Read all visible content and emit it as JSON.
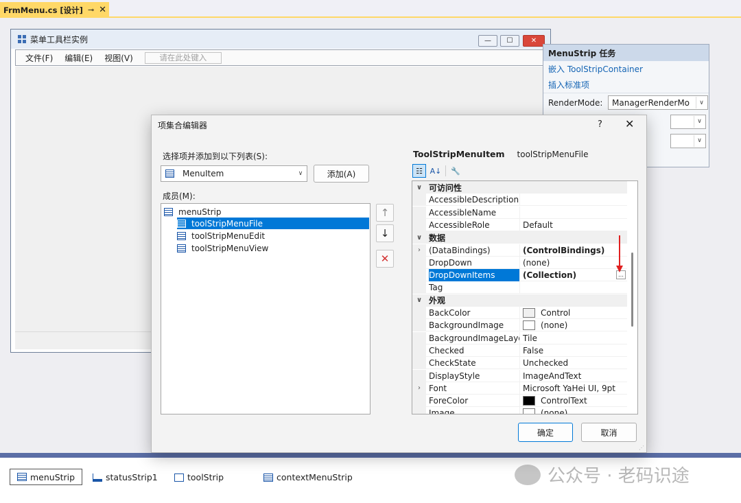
{
  "tab": {
    "title": "FrmMenu.cs [设计]",
    "pin": "⊸",
    "close": "✕"
  },
  "form": {
    "title": "菜单工具栏实例",
    "controls": {
      "minimize": "—",
      "maximize": "☐",
      "close": "✕"
    },
    "menu": [
      "文件(F)",
      "编辑(E)",
      "视图(V)"
    ],
    "type_here": "请在此处键入"
  },
  "tasks": {
    "header": "MenuStrip 任务",
    "links": [
      "嵌入 ToolStripContainer",
      "插入标准项"
    ],
    "render_mode_label": "RenderMode:",
    "render_mode_value": "ManagerRenderMo"
  },
  "dialog": {
    "title": "项集合编辑器",
    "help": "?",
    "close": "✕",
    "select_label": "选择项并添加到以下列表(S):",
    "select_value": "MenuItem",
    "add_button": "添加(A)",
    "members_label": "成员(M):",
    "members": [
      {
        "label": "menuStrip",
        "selected": false
      },
      {
        "label": "toolStripMenuFile",
        "selected": true
      },
      {
        "label": "toolStripMenuEdit",
        "selected": false
      },
      {
        "label": "toolStripMenuView",
        "selected": false
      }
    ],
    "move_up": "↑",
    "move_down": "↓",
    "delete": "✕",
    "prop_header_type": "ToolStripMenuItem",
    "prop_header_name": "toolStripMenuFile",
    "properties": [
      {
        "kind": "cat",
        "name": "可访问性"
      },
      {
        "name": "AccessibleDescription",
        "value": ""
      },
      {
        "name": "AccessibleName",
        "value": ""
      },
      {
        "name": "AccessibleRole",
        "value": "Default"
      },
      {
        "kind": "cat",
        "name": "数据"
      },
      {
        "name": "(DataBindings)",
        "value": "(ControlBindings)",
        "bold": true,
        "expand": true
      },
      {
        "name": "DropDown",
        "value": "(none)"
      },
      {
        "name": "DropDownItems",
        "value": "(Collection)",
        "bold": true,
        "selected": true,
        "ellipsis": true
      },
      {
        "name": "Tag",
        "value": ""
      },
      {
        "kind": "cat",
        "name": "外观"
      },
      {
        "name": "BackColor",
        "value": "Control",
        "swatch": "#f0f0f0"
      },
      {
        "name": "BackgroundImage",
        "value": "(none)",
        "swatch": "#ffffff"
      },
      {
        "name": "BackgroundImageLayout",
        "value": "Tile"
      },
      {
        "name": "Checked",
        "value": "False"
      },
      {
        "name": "CheckState",
        "value": "Unchecked"
      },
      {
        "name": "DisplayStyle",
        "value": "ImageAndText"
      },
      {
        "name": "Font",
        "value": "Microsoft YaHei UI, 9pt",
        "expand": true
      },
      {
        "name": "ForeColor",
        "value": "ControlText",
        "swatch": "#000000"
      },
      {
        "name": "Image",
        "value": "(none)",
        "swatch": "#ffffff"
      }
    ],
    "ok": "确定",
    "cancel": "取消"
  },
  "tray": [
    "menuStrip",
    "statusStrip1",
    "toolStrip",
    "contextMenuStrip"
  ],
  "watermark": "公众号 · 老码识途",
  "colors": {
    "accent": "#0078d7",
    "tab": "#ffd867",
    "link": "#1464b4",
    "annotation_arrow": "#e02020"
  }
}
